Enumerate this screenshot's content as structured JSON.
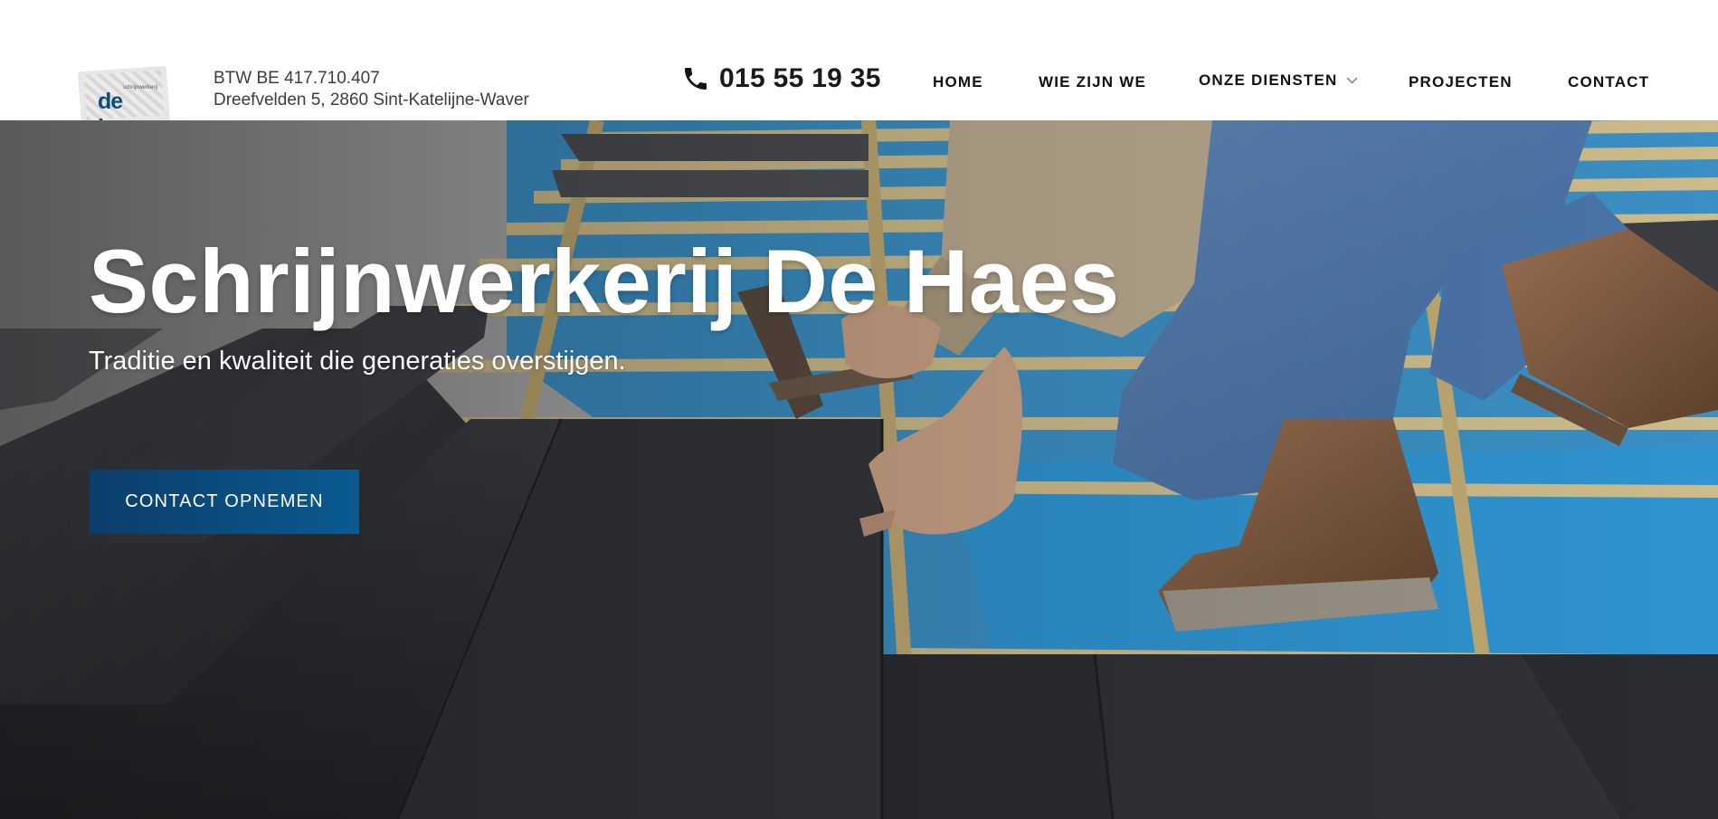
{
  "company": {
    "logo_text": "de haes",
    "logo_small_text": "schrijnwerkerij",
    "vat": "BTW BE 417.710.407",
    "address": "Dreefvelden 5, 2860 Sint-Katelijne-Waver"
  },
  "contact": {
    "phone": "015 55 19 35",
    "phone_icon": "phone-icon"
  },
  "nav": {
    "items": [
      {
        "label": "HOME"
      },
      {
        "label": "WIE ZIJN WE"
      },
      {
        "label": "ONZE DIENSTEN",
        "has_dropdown": true
      },
      {
        "label": "PROJECTEN"
      },
      {
        "label": "CONTACT"
      }
    ]
  },
  "hero": {
    "title": "Schrijnwerkerij De Haes",
    "subtitle": "Traditie en kwaliteit die generaties overstijgen.",
    "cta_label": "CONTACT OPNEMEN"
  },
  "colors": {
    "brand_blue": "#0c4f82",
    "nav_text": "#111111",
    "hero_text": "#ffffff"
  }
}
